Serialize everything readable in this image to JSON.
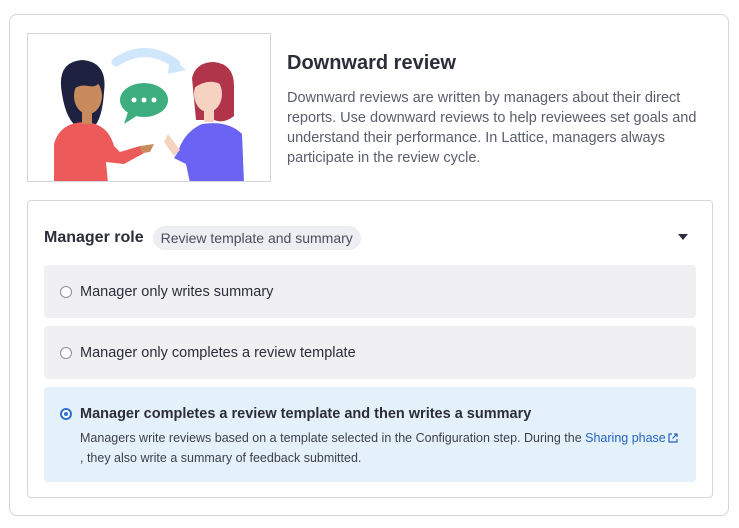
{
  "section": {
    "title": "Downward review",
    "description": "Downward reviews are written by managers about their direct reports. Use downward reviews to help reviewees set goals and understand their performance. In Lattice, managers always participate in the review cycle."
  },
  "manager_role": {
    "title": "Manager role",
    "badge": "Review template and summary",
    "options": [
      {
        "label": "Manager only writes summary",
        "selected": false
      },
      {
        "label": "Manager only completes a review template",
        "selected": false
      },
      {
        "label": "Manager completes a review template and then writes a summary",
        "selected": true,
        "desc_before": "Managers write reviews based on a template selected in the Configuration step. During the ",
        "desc_link": "Sharing phase",
        "desc_after": ", they also write a summary of feedback submitted."
      }
    ]
  },
  "colors": {
    "accent": "#2f6fd6",
    "selected_bg": "#e5f1fa",
    "option_bg": "#f0f0f3"
  },
  "icons": [
    "chat-bubble-icon",
    "arrow-icon",
    "caret-down-icon",
    "external-link-icon"
  ]
}
